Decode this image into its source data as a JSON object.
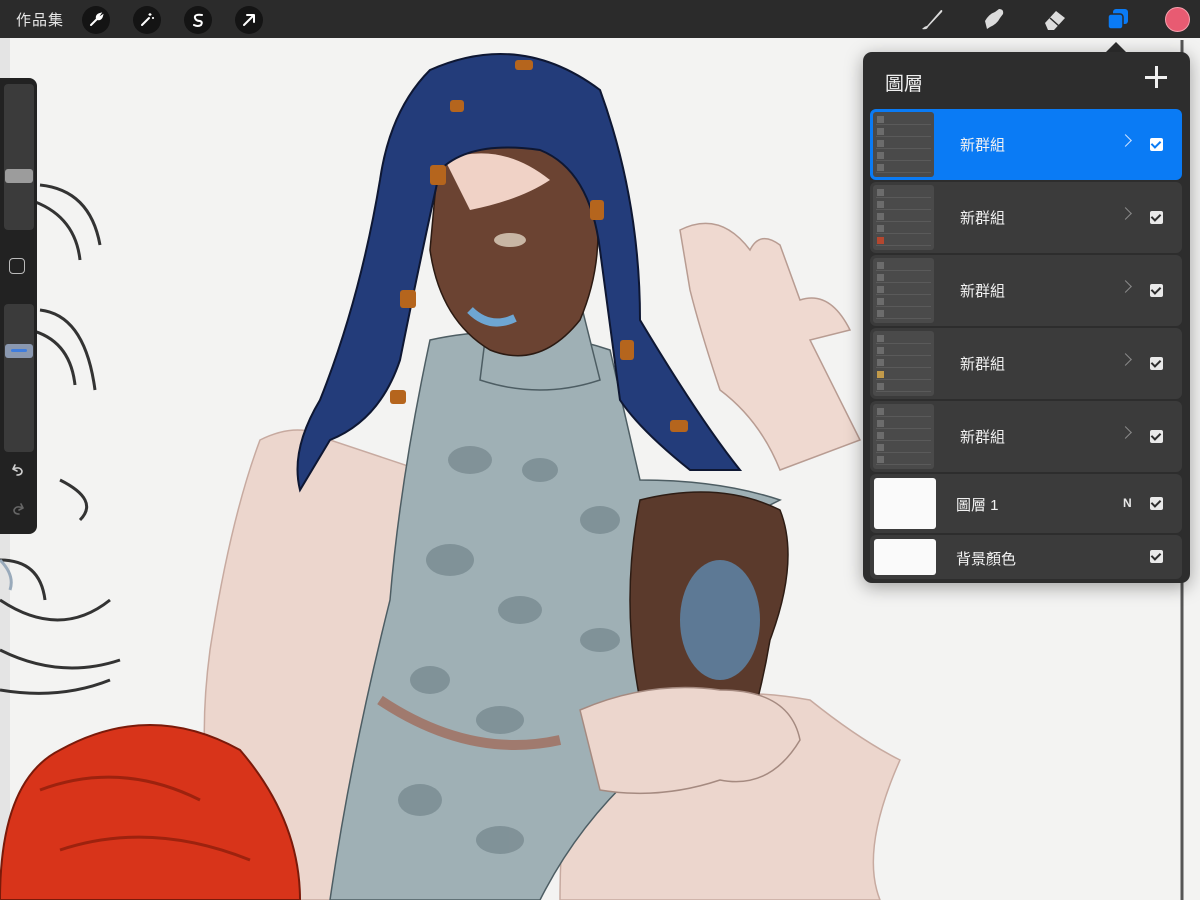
{
  "topbar": {
    "gallery_label": "作品集",
    "left_tools": [
      "wrench-icon",
      "magic-wand-icon",
      "selection-icon",
      "transform-arrow-icon"
    ],
    "right_tools": [
      "brush-icon",
      "smudge-icon",
      "eraser-icon",
      "layers-icon"
    ],
    "active_color": "#e85b72",
    "active_tool_accent": "#0a7bf5"
  },
  "layers_panel": {
    "title": "圖層",
    "layers": [
      {
        "name": "新群組",
        "type": "group",
        "selected": true,
        "visible": true
      },
      {
        "name": "新群組",
        "type": "group",
        "selected": false,
        "visible": true
      },
      {
        "name": "新群組",
        "type": "group",
        "selected": false,
        "visible": true
      },
      {
        "name": "新群組",
        "type": "group",
        "selected": false,
        "visible": true
      },
      {
        "name": "新群組",
        "type": "group",
        "selected": false,
        "visible": true
      },
      {
        "name": "圖層 1",
        "type": "layer",
        "blend_mode": "N",
        "selected": false,
        "visible": true
      },
      {
        "name": "背景顏色",
        "type": "background",
        "selected": false,
        "visible": true
      }
    ]
  },
  "sidebar": {
    "brush_size_level": 0.6,
    "opacity_level": 0.67
  }
}
